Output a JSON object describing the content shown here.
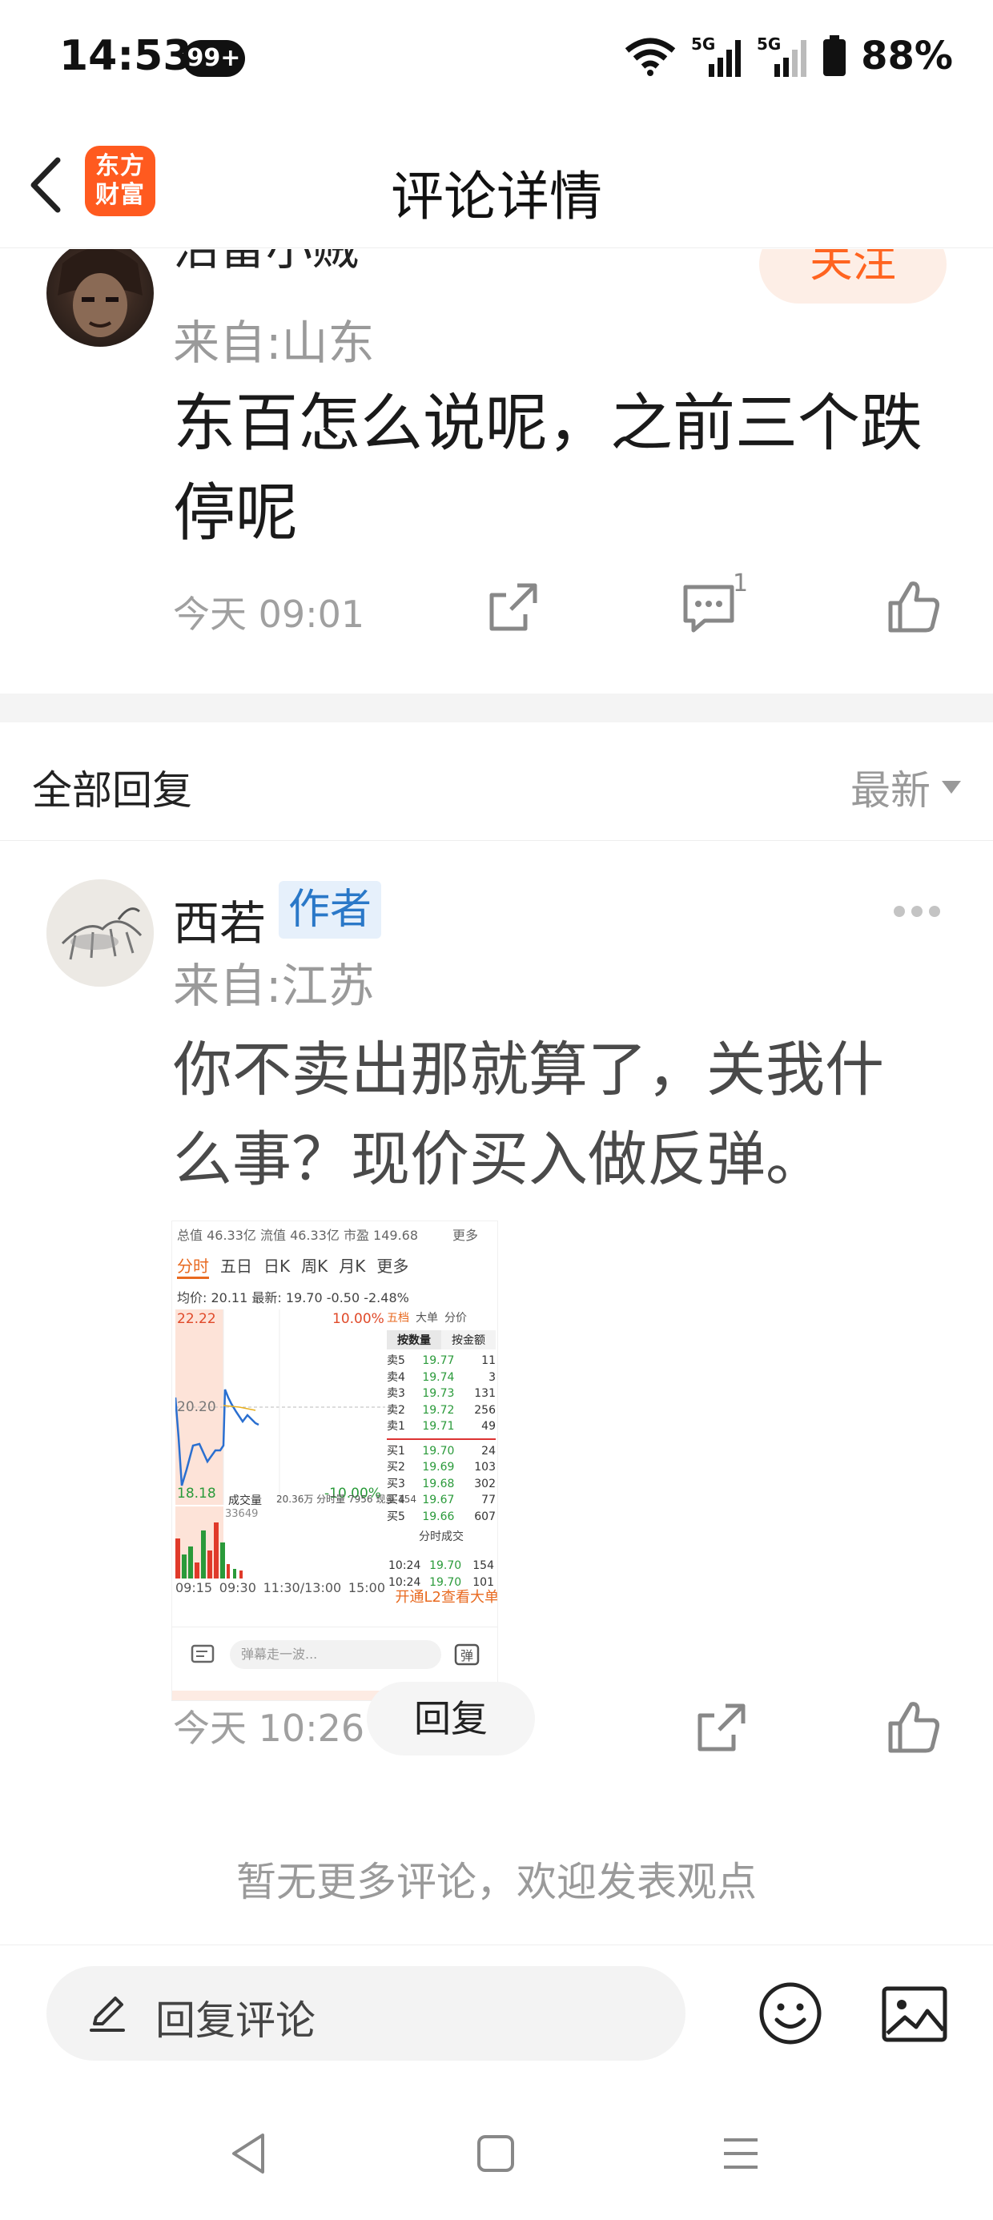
{
  "status_bar": {
    "time": "14:53",
    "notification_badge": "99+",
    "network_1": "5G",
    "network_2": "5G",
    "battery": "88%"
  },
  "header": {
    "title": "评论详情",
    "logo_line1": "东方",
    "logo_line2": "财富",
    "brand_color": "#ff5a1f"
  },
  "main_comment": {
    "username": "沼雷小贼",
    "follow_label": "关注",
    "origin": "来自:山东",
    "content": "东百怎么说呢，之前三个跌停呢",
    "time": "今天 09:01",
    "reply_count": "1"
  },
  "replies": {
    "title": "全部回复",
    "sort_label": "最新"
  },
  "reply": {
    "username": "西若",
    "author_badge": "作者",
    "origin": "来自:江苏",
    "content": "你不卖出那就算了，关我什么事？现价买入做反弹。",
    "time": "今天 10:26",
    "reply_button": "回复",
    "attachment": {
      "top_line": "总值 46.33亿  流值 46.33亿  市盈 149.68",
      "top_more": "更多",
      "tabs": [
        "分时",
        "五日",
        "日K",
        "周K",
        "月K",
        "更多"
      ],
      "info_line": "均价: 20.11  最新: 19.70  -0.50  -2.48%",
      "price_high": "22.22",
      "price_mid": "20.20",
      "price_low": "18.18",
      "pct_high": "10.00%",
      "pct_low": "-10.00%",
      "volume_label": "成交量",
      "volume_value": "33649",
      "volume_info": "20.36万  分时量 7956  现量 154",
      "times": [
        "09:15",
        "09:30",
        "11:30/13:00",
        "15:00"
      ],
      "book_tabs": [
        "五档",
        "大单",
        "分价"
      ],
      "book_subtabs": [
        "按数量",
        "按金额"
      ],
      "asks": [
        {
          "label": "卖5",
          "price": "19.77",
          "vol": "11"
        },
        {
          "label": "卖4",
          "price": "19.74",
          "vol": "3"
        },
        {
          "label": "卖3",
          "price": "19.73",
          "vol": "131"
        },
        {
          "label": "卖2",
          "price": "19.72",
          "vol": "256"
        },
        {
          "label": "卖1",
          "price": "19.71",
          "vol": "49"
        }
      ],
      "bids": [
        {
          "label": "买1",
          "price": "19.70",
          "vol": "24"
        },
        {
          "label": "买2",
          "price": "19.69",
          "vol": "103"
        },
        {
          "label": "买3",
          "price": "19.68",
          "vol": "302"
        },
        {
          "label": "买4",
          "price": "19.67",
          "vol": "77"
        },
        {
          "label": "买5",
          "price": "19.66",
          "vol": "607"
        }
      ],
      "trade_title": "分时成交",
      "trades": [
        {
          "time": "10:24",
          "price": "19.70",
          "vol": "154"
        },
        {
          "time": "10:24",
          "price": "19.70",
          "vol": "101"
        }
      ],
      "cta": "开通L2查看大单",
      "danmaku_placeholder": "弹幕走一波..."
    }
  },
  "no_more_text": "暂无更多评论，欢迎发表观点",
  "input_bar": {
    "placeholder": "回复评论"
  }
}
